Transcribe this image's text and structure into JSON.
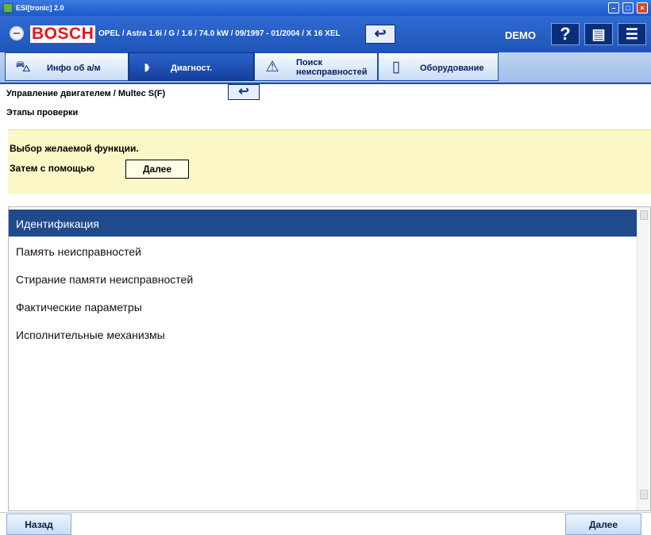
{
  "window": {
    "title": "ESI[tronic] 2.0"
  },
  "header": {
    "brand": "BOSCH",
    "vehicle": "OPEL / Astra 1.6i / G / 1.6 / 74.0 kW / 09/1997 - 01/2004 / X 16 XEL",
    "demo_label": "DEMO"
  },
  "tabs": [
    {
      "label": "Инфо об а/м",
      "icon": "car-icon",
      "active": false
    },
    {
      "label": "Диагност.",
      "icon": "diagnostic-plug-icon",
      "active": true
    },
    {
      "label": "Поиск неисправностей",
      "icon": "troubleshooting-icon",
      "active": false
    },
    {
      "label": "Оборудование",
      "icon": "book-icon",
      "active": false
    }
  ],
  "breadcrumb": {
    "path": "Управление двигателем / Multec S(F)"
  },
  "subheading": "Этапы проверки",
  "hint": {
    "line1": "Выбор желаемой функции.",
    "line2_prefix": "Затем с помощью",
    "inline_button": "Далее"
  },
  "list": {
    "items": [
      {
        "label": "Идентификация",
        "selected": true
      },
      {
        "label": "Память неисправностей",
        "selected": false
      },
      {
        "label": "Стирание памяти неисправностей",
        "selected": false
      },
      {
        "label": "Фактические параметры",
        "selected": false
      },
      {
        "label": "Исполнительные механизмы",
        "selected": false
      }
    ]
  },
  "footer": {
    "back_label": "Назад",
    "next_label": "Далее"
  },
  "colors": {
    "header_blue": "#1f55b8",
    "selected_row": "#1f4a8c",
    "hint_background": "#fcf7c6",
    "brand_red": "#e8131f"
  }
}
